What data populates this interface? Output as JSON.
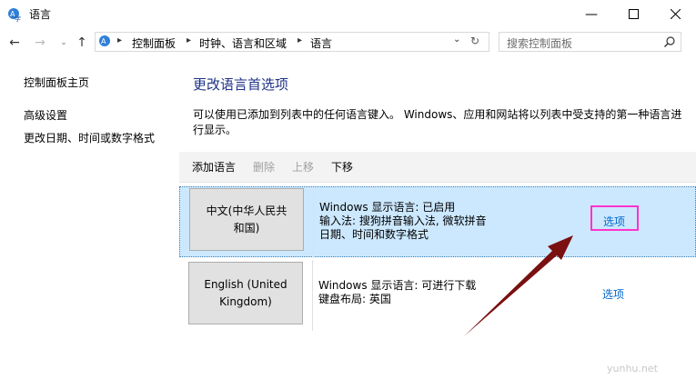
{
  "window": {
    "title": "语言"
  },
  "address": {
    "crumbs": [
      "控制面板",
      "时钟、语言和区域",
      "语言"
    ]
  },
  "search": {
    "placeholder": "搜索控制面板"
  },
  "sidebar": {
    "items": [
      {
        "label": "控制面板主页"
      },
      {
        "label": "高级设置"
      },
      {
        "label": "更改日期、时间或数字格式"
      }
    ]
  },
  "main": {
    "title": "更改语言首选项",
    "description": "可以使用已添加到列表中的任何语言键入。 Windows、应用和网站将以列表中受支持的第一种语言进行显示。"
  },
  "toolbar": {
    "add": "添加语言",
    "remove": "删除",
    "up": "上移",
    "down": "下移"
  },
  "languages": [
    {
      "name_line1": "中文(中华人民共",
      "name_line2": "和国)",
      "info1": "Windows 显示语言: 已启用",
      "info2": "输入法: 搜狗拼音输入法, 微软拼音",
      "info3": "日期、时间和数字格式",
      "options": "选项"
    },
    {
      "name_line1": "English (United",
      "name_line2": "Kingdom)",
      "info1": "Windows 显示语言: 可进行下载",
      "info2": "键盘布局: 英国",
      "info3": "",
      "options": "选项"
    }
  ],
  "watermark": "yunhu.net",
  "colors": {
    "link": "#0066cc",
    "title": "#1e3287",
    "selected_row": "#cce8ff",
    "highlight": "#ff33cc",
    "arrow": "#7a1010"
  }
}
